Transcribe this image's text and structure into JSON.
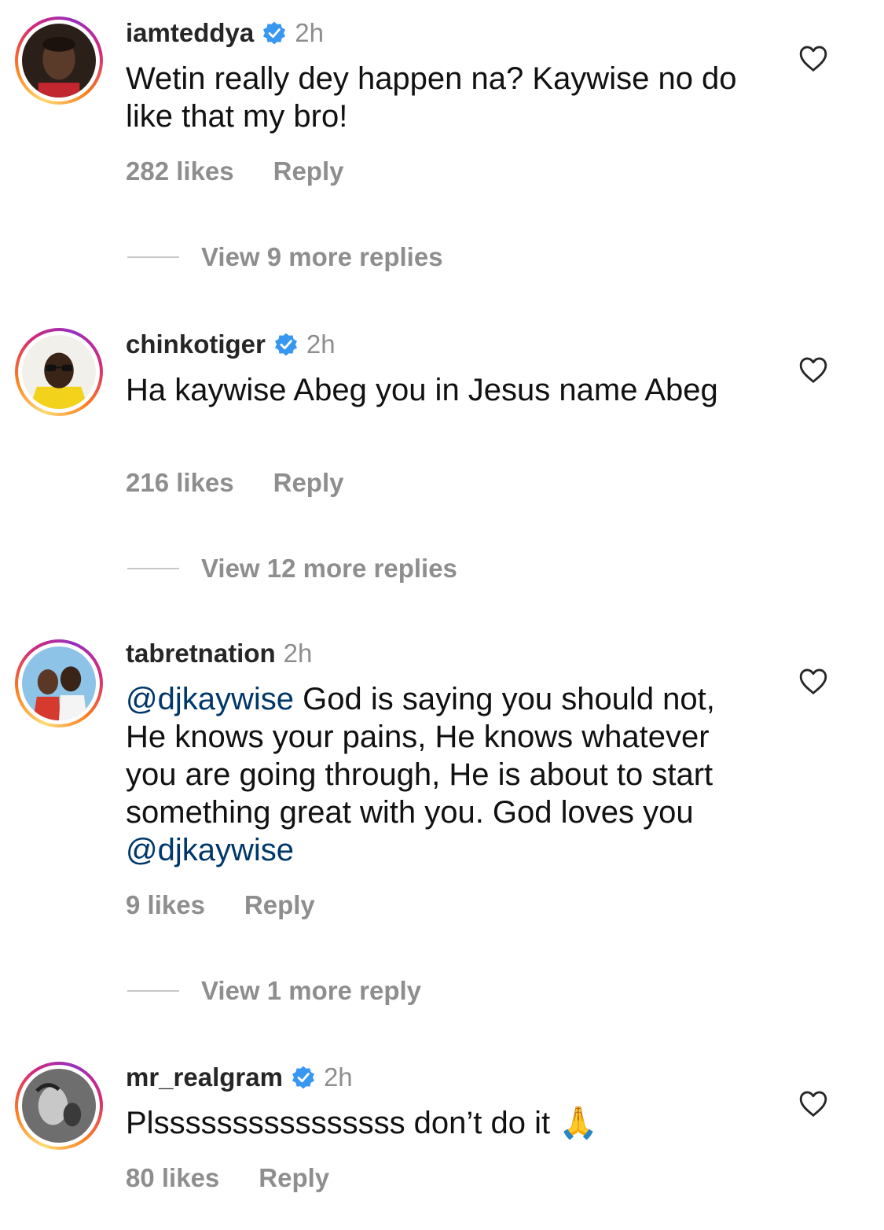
{
  "comments": [
    {
      "username": "iamteddya",
      "verified": true,
      "time": "2h",
      "text": "Wetin really dey happen na? Kaywise no do like that my bro!",
      "likes": "282 likes",
      "reply": "Reply",
      "view_replies": "View 9 more replies"
    },
    {
      "username": "chinkotiger",
      "verified": true,
      "time": "2h",
      "text": "Ha kaywise Abeg you in Jesus name Abeg",
      "likes": "216 likes",
      "reply": "Reply",
      "view_replies": "View 12 more replies"
    },
    {
      "username": "tabretnation",
      "verified": false,
      "time": "2h",
      "mention_start": "@djkaywise",
      "text": " God is saying you should not, He knows your pains, He knows whatever you are going through, He is about to start something great with you. God loves you ",
      "mention_end": "@djkaywise",
      "likes": "9 likes",
      "reply": "Reply",
      "view_replies": "View 1 more reply"
    },
    {
      "username": "mr_realgram",
      "verified": true,
      "time": "2h",
      "text": "Plssssssssssssssss don’t do it",
      "emoji": "🙏",
      "likes": "80 likes",
      "reply": "Reply"
    }
  ],
  "icons": {
    "verified": "verified-badge-icon",
    "like": "heart-outline-icon"
  },
  "colors": {
    "verified_blue": "#3897f0",
    "mention": "#00376b",
    "muted": "#8e8e8e"
  }
}
